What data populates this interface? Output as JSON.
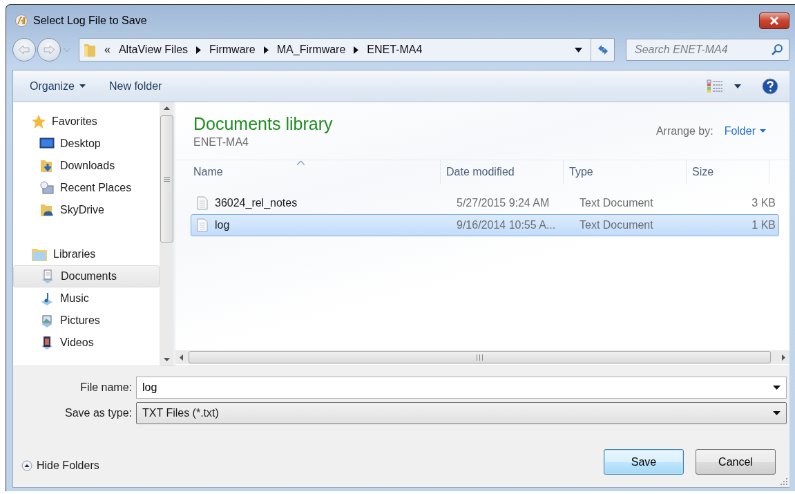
{
  "window": {
    "title": "Select Log File to Save"
  },
  "address_bar": {
    "overflow": "«",
    "segments": [
      "AltaView Files",
      "Firmware",
      "MA_Firmware",
      "ENET-MA4"
    ]
  },
  "search": {
    "placeholder": "Search ENET-MA4"
  },
  "toolbar": {
    "organize": "Organize",
    "new_folder": "New folder"
  },
  "sidebar": {
    "groups": [
      {
        "label": "Favorites",
        "items": [
          {
            "label": "Desktop",
            "selected": false
          },
          {
            "label": "Downloads",
            "selected": false
          },
          {
            "label": "Recent Places",
            "selected": false
          },
          {
            "label": "SkyDrive",
            "selected": false
          }
        ]
      },
      {
        "label": "Libraries",
        "items": [
          {
            "label": "Documents",
            "selected": true
          },
          {
            "label": "Music",
            "selected": false
          },
          {
            "label": "Pictures",
            "selected": false
          },
          {
            "label": "Videos",
            "selected": false
          }
        ]
      }
    ]
  },
  "library": {
    "title": "Documents library",
    "subtitle": "ENET-MA4",
    "arrange_label": "Arrange by:",
    "arrange_value": "Folder"
  },
  "table": {
    "columns": [
      {
        "label": "Name",
        "sorted": true
      },
      {
        "label": "Date modified",
        "sorted": false
      },
      {
        "label": "Type",
        "sorted": false
      },
      {
        "label": "Size",
        "sorted": false
      }
    ],
    "rows": [
      {
        "name": "36024_rel_notes",
        "date": "5/27/2015 9:24 AM",
        "type": "Text Document",
        "size": "3 KB",
        "selected": false
      },
      {
        "name": "log",
        "date": "9/16/2014 10:55 A...",
        "type": "Text Document",
        "size": "1 KB",
        "selected": true
      }
    ]
  },
  "file_name": {
    "label": "File name:",
    "value": "log"
  },
  "save_type": {
    "label": "Save as type:",
    "value": "TXT Files (*.txt)"
  },
  "hide_folders": "Hide Folders",
  "buttons": [
    {
      "label": "Save",
      "default": true
    },
    {
      "label": "Cancel",
      "default": false
    }
  ]
}
